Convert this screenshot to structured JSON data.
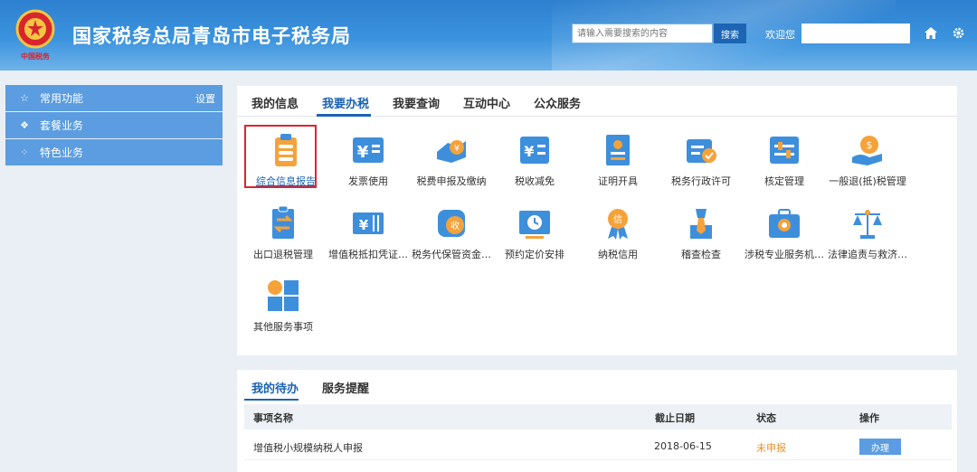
{
  "header": {
    "title": "国家税务总局青岛市电子税务局",
    "emblem_text": "中国税务",
    "search_placeholder": "请输入需要搜索的内容",
    "search_button": "搜索",
    "welcome": "欢迎您",
    "home_icon": "home-icon",
    "settings_icon": "gear-icon"
  },
  "sidebar": {
    "items": [
      {
        "label": "常用功能",
        "icon": "star-icon",
        "right": "设置"
      },
      {
        "label": "套餐业务",
        "icon": "layers-icon",
        "right": ""
      },
      {
        "label": "特色业务",
        "icon": "grid-icon",
        "right": ""
      }
    ]
  },
  "main": {
    "tabs": [
      {
        "label": "我的信息"
      },
      {
        "label": "我要办税"
      },
      {
        "label": "我要查询"
      },
      {
        "label": "互动中心"
      },
      {
        "label": "公众服务"
      }
    ],
    "active_tab": "我要办税",
    "services": [
      {
        "label": "综合信息报告",
        "icon": "clipboard-icon"
      },
      {
        "label": "发票使用",
        "icon": "invoice-icon"
      },
      {
        "label": "税费申报及缴纳",
        "icon": "payment-icon"
      },
      {
        "label": "税收减免",
        "icon": "tax-reduction-icon"
      },
      {
        "label": "证明开具",
        "icon": "certificate-icon"
      },
      {
        "label": "税务行政许可",
        "icon": "approval-icon"
      },
      {
        "label": "核定管理",
        "icon": "sliders-icon"
      },
      {
        "label": "一般退(抵)税管理",
        "icon": "refund-icon"
      },
      {
        "label": "出口退税管理",
        "icon": "export-icon"
      },
      {
        "label": "增值税抵扣凭证…",
        "icon": "voucher-icon"
      },
      {
        "label": "税务代保管资金…",
        "icon": "custody-icon"
      },
      {
        "label": "预约定价安排",
        "icon": "schedule-icon"
      },
      {
        "label": "纳税信用",
        "icon": "medal-icon"
      },
      {
        "label": "稽查检查",
        "icon": "inspector-icon"
      },
      {
        "label": "涉税专业服务机…",
        "icon": "briefcase-icon"
      },
      {
        "label": "法律追责与救济…",
        "icon": "scales-icon"
      },
      {
        "label": "其他服务事项",
        "icon": "tiles-icon"
      }
    ]
  },
  "todo": {
    "tabs": [
      {
        "label": "我的待办"
      },
      {
        "label": "服务提醒"
      }
    ],
    "columns": [
      "事项名称",
      "截止日期",
      "状态",
      "操作"
    ],
    "rows": [
      {
        "name": "增值税小规模纳税人申报",
        "deadline": "2018-06-15",
        "status": "未申报",
        "action": "办理"
      }
    ]
  },
  "colors": {
    "brand_blue": "#1b63b4",
    "header_blue": "#3b93de",
    "sidebar_blue": "#5b9de0",
    "highlight_red": "#e0242c",
    "icon_blue": "#3d8fdc",
    "icon_orange": "#f5a23a",
    "status_orange": "#e8912c"
  }
}
